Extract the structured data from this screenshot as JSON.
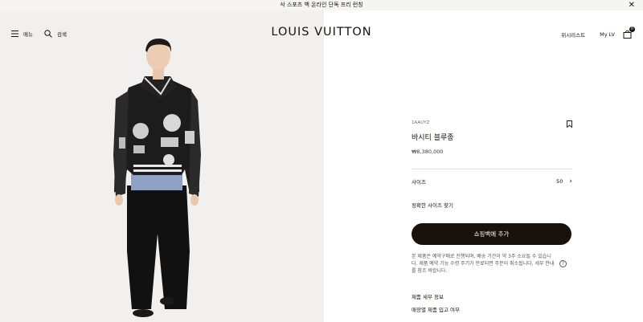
{
  "banner": {
    "text": "삭 스포츠 백 온라인 단독 프리 런칭"
  },
  "header": {
    "menu_label": "메뉴",
    "search_label": "검색",
    "brand": "LOUIS VUITTON",
    "wishlist_label": "위시리스트",
    "mylv_label": "My LV",
    "bag_count": "0"
  },
  "product": {
    "sku": "1AAUYZ",
    "name": "바시티 블루종",
    "price": "₩8,380,000",
    "size_label": "사이즈",
    "size_value": "50",
    "find_size": "정확한 사이즈 찾기",
    "add_to_cart": "쇼핑백에 추가",
    "notice": "본 제품은 예약구매로 진행되며, 배송 기간이 약 3주 소요될 수 있습니다. 제품 예약 기능 수령 주기가 만료되면 주문이 취소됩니다. 세부 안내를 참조 바랍니다.",
    "details_link": "제품 세부 정보",
    "stock_link": "매장별 제품 입고 여부"
  },
  "colors": {
    "accent": "#19110b",
    "image_bg": "#f1f0ee"
  }
}
